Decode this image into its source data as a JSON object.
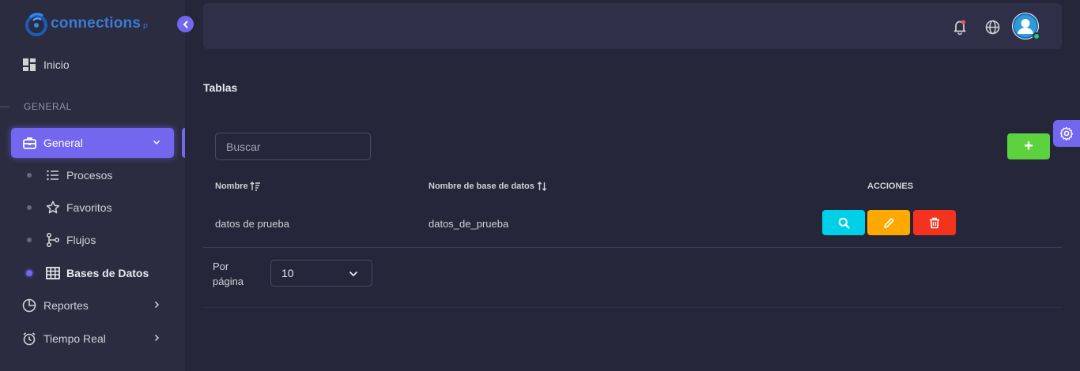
{
  "brand": {
    "name": "connections",
    "suffix": "P"
  },
  "sidebar": {
    "inicio": "Inicio",
    "section": "GENERAL",
    "general": "General",
    "sub_items": [
      "Procesos",
      "Favoritos",
      "Flujos",
      "Bases de Datos"
    ],
    "reportes": "Reportes",
    "tiempo_real": "Tiempo Real"
  },
  "page": {
    "title": "Tablas"
  },
  "search": {
    "placeholder": "Buscar",
    "value": ""
  },
  "add_button": {
    "label": "+"
  },
  "table": {
    "headers": [
      "Nombre",
      "Nombre de base de datos",
      "ACCIONES"
    ],
    "rows": [
      {
        "nombre": "datos de prueba",
        "base": "datos_de_prueba"
      }
    ]
  },
  "pagination": {
    "label_line1": "Por",
    "label_line2": "página",
    "value": "10"
  },
  "colors": {
    "accent": "#7367f0",
    "success": "#5dd23f",
    "info": "#00cfe8",
    "warning": "#ff9f43",
    "danger": "#ea5455"
  }
}
